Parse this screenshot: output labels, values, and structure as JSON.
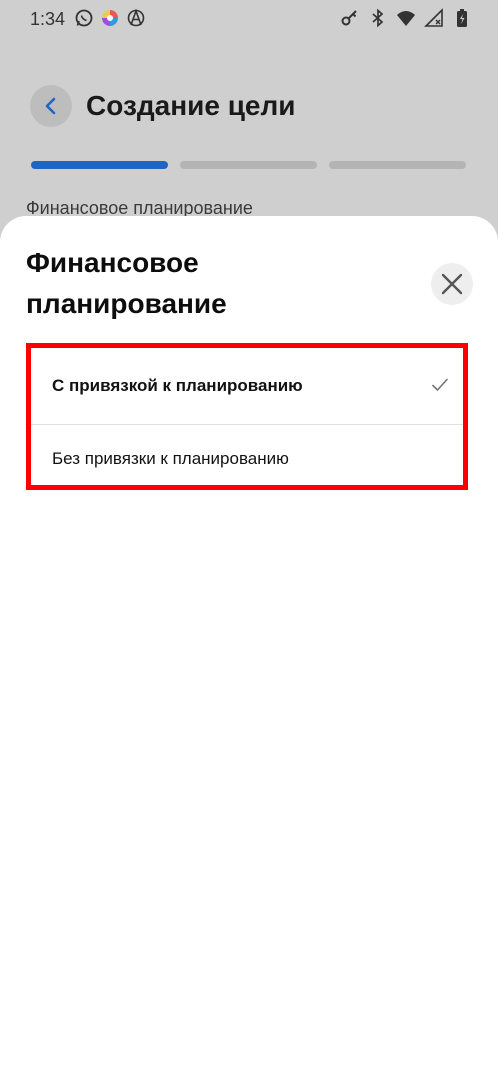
{
  "status_bar": {
    "time": "1:34",
    "left_icons": [
      "whatsapp-icon",
      "colorful-app-icon",
      "anarchy-icon"
    ],
    "right_icons": [
      "key-icon",
      "bluetooth-icon",
      "wifi-icon",
      "signal-icon",
      "battery-charging-icon"
    ]
  },
  "header": {
    "back_icon": "chevron-left-icon",
    "title": "Создание цели"
  },
  "progress": {
    "steps_total": 3,
    "current_step": 1,
    "active_color": "#1f66c1",
    "inactive_color": "#b4b4b4"
  },
  "background_section_label": "Финансовое планирование",
  "sheet": {
    "title": "Финансовое планирование",
    "close_icon": "close-icon",
    "options": [
      {
        "label": "С привязкой к планированию",
        "selected": true
      },
      {
        "label": "Без привязки к планированию",
        "selected": false
      }
    ],
    "highlight_color": "#ff0000"
  }
}
